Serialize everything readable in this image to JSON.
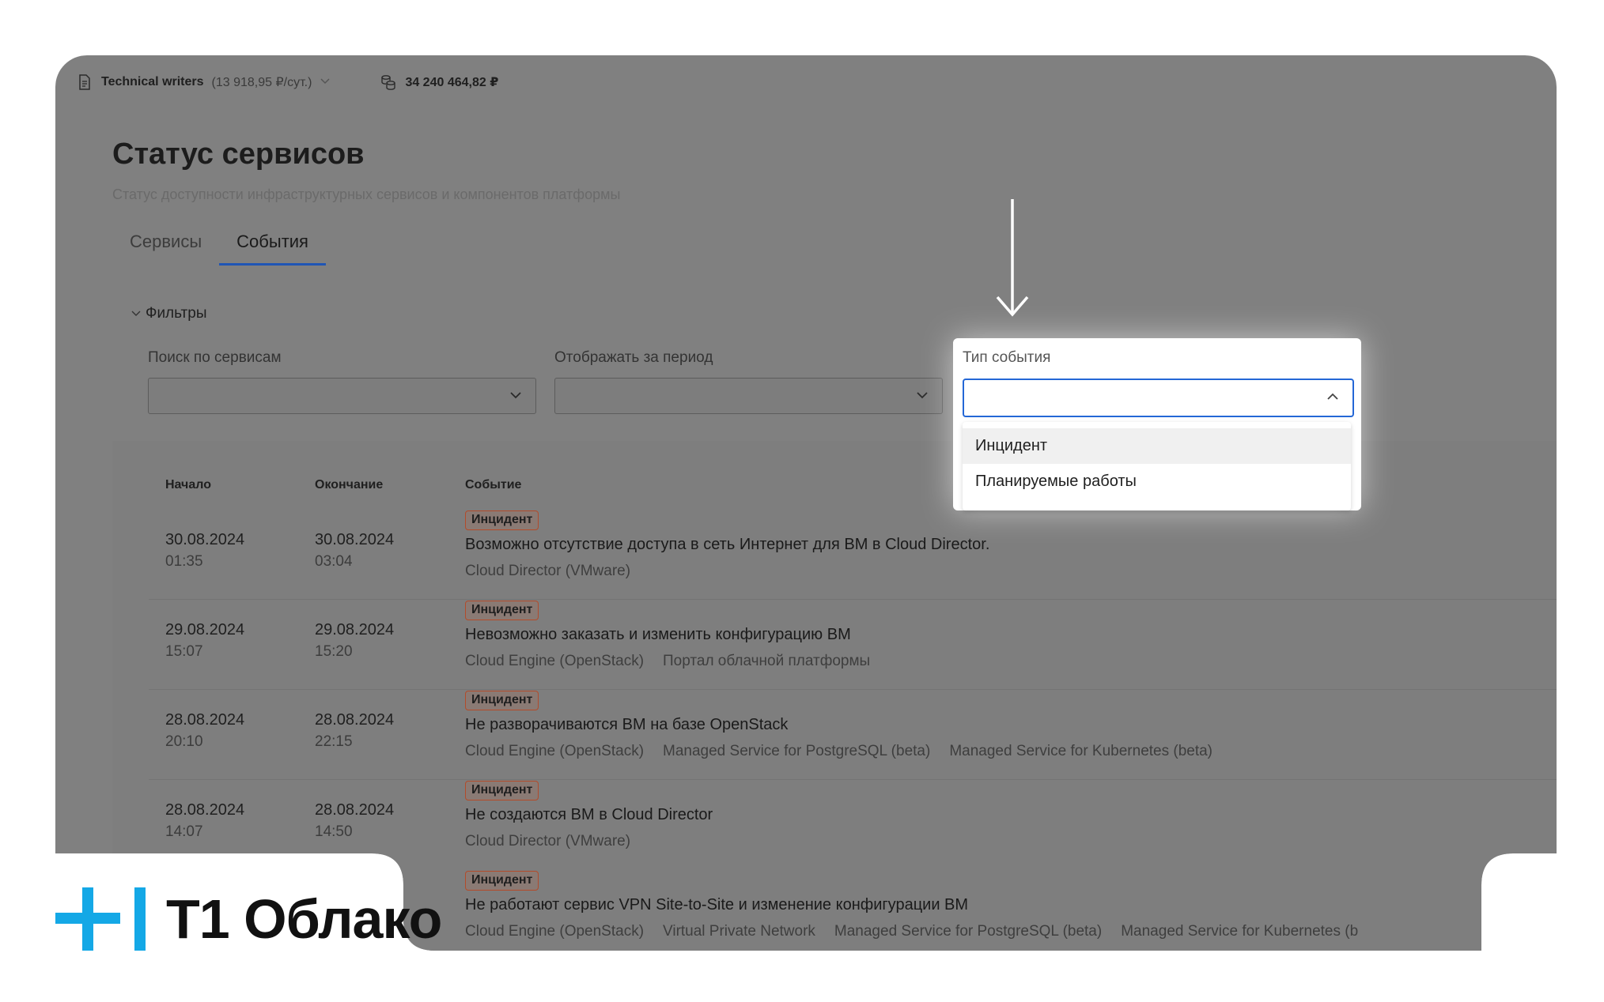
{
  "topbar": {
    "project": "Technical writers",
    "project_rate": "(13 918,95 ₽/сут.)",
    "balance": "34 240 464,82 ₽"
  },
  "page": {
    "title": "Статус сервисов",
    "subtitle": "Статус доступности инфраструктурных сервисов и компонентов платформы"
  },
  "tabs": [
    {
      "label": "Сервисы",
      "active": false
    },
    {
      "label": "События",
      "active": true
    }
  ],
  "filters": {
    "toggle_label": "Фильтры",
    "service_search_label": "Поиск по сервисам",
    "period_label": "Отображать за период",
    "event_type_label": "Тип события",
    "event_type_value": "",
    "event_type_options": [
      "Инцидент",
      "Планируемые работы"
    ]
  },
  "table": {
    "headers": {
      "start": "Начало",
      "end": "Окончание",
      "event": "Событие"
    },
    "rows": [
      {
        "start_date": "30.08.2024",
        "start_time": "01:35",
        "end_date": "30.08.2024",
        "end_time": "03:04",
        "badge": "Инцидент",
        "title": "Возможно отсутствие доступа в сеть Интернет для ВМ в Cloud Director.",
        "services": [
          "Cloud Director (VMware)"
        ]
      },
      {
        "start_date": "29.08.2024",
        "start_time": "15:07",
        "end_date": "29.08.2024",
        "end_time": "15:20",
        "badge": "Инцидент",
        "title": "Невозможно заказать и изменить конфигурацию ВМ",
        "services": [
          "Cloud Engine (OpenStack)",
          "Портал облачной платформы"
        ]
      },
      {
        "start_date": "28.08.2024",
        "start_time": "20:10",
        "end_date": "28.08.2024",
        "end_time": "22:15",
        "badge": "Инцидент",
        "title": "Не разворачиваются ВМ на базе OpenStack",
        "services": [
          "Cloud Engine (OpenStack)",
          "Managed Service for PostgreSQL (beta)",
          "Managed Service for Kubernetes (beta)"
        ]
      },
      {
        "start_date": "28.08.2024",
        "start_time": "14:07",
        "end_date": "28.08.2024",
        "end_time": "14:50",
        "badge": "Инцидент",
        "title": "Не создаются ВМ в Cloud Director",
        "services": [
          "Cloud Director (VMware)"
        ]
      },
      {
        "start_date": "",
        "start_time": "",
        "end_date": "",
        "end_time": "",
        "badge": "Инцидент",
        "title": "Не работают сервис VPN Site-to-Site и изменение конфигурации ВМ",
        "services": [
          "Cloud Engine (OpenStack)",
          "Virtual Private Network",
          "Managed Service for PostgreSQL (beta)",
          "Managed Service for Kubernetes (b"
        ]
      }
    ]
  },
  "brand": {
    "name": "T1 Облако",
    "accent_color": "#14a8e6"
  }
}
